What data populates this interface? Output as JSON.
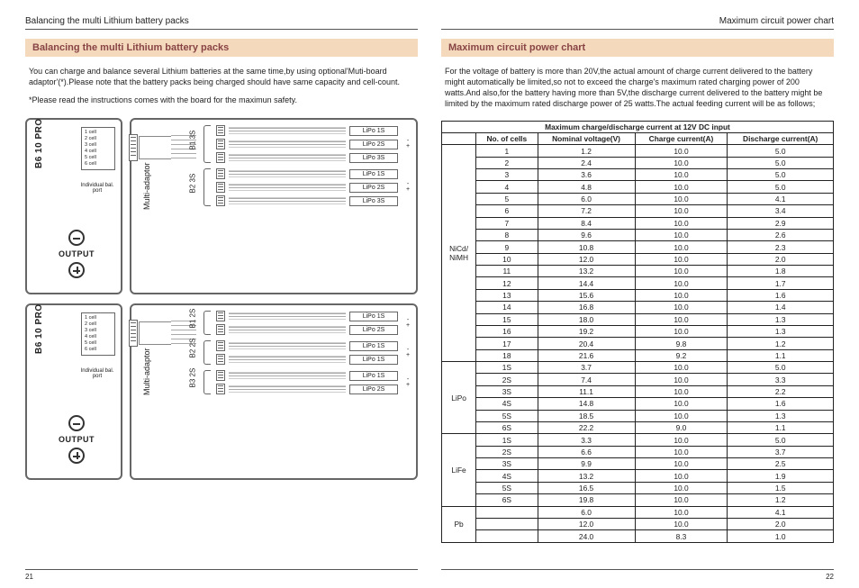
{
  "headerLeft": "Balancing the multi Lithium battery packs",
  "headerRight": "Maximum circuit power chart",
  "left": {
    "title": "Balancing the multi Lithium battery packs",
    "para1": "You can charge and balance several Lithium batteries at the same time,by using optional'Muti-board adaptor'(*).Please note that the battery packs being charged should have same capacity and cell-count.",
    "para2": "*Please read the instructions comes with the board for the maximun safety.",
    "deviceName": "B6 10 PRO",
    "cellLabels": [
      "1 cell",
      "2 cell",
      "3 cell",
      "4 cell",
      "5 cell",
      "6 cell"
    ],
    "cellCaption": "Individual bal. port",
    "output": "OUTPUT",
    "adaptorCaption": "Multi-adaptor",
    "diag1": {
      "groups": [
        {
          "label": "B1 3S",
          "slots": [
            "LiPo 1S",
            "LiPo 2S",
            "LiPo 3S"
          ],
          "pol": true
        },
        {
          "label": "B2 3S",
          "slots": [
            "LiPo 1S",
            "LiPo 2S",
            "LiPo 3S"
          ],
          "pol": true
        }
      ]
    },
    "diag2": {
      "groups": [
        {
          "label": "B1 2S",
          "slots": [
            "LiPo 1S",
            "LiPo 2S"
          ],
          "pol": true
        },
        {
          "label": "B2 2S",
          "slots": [
            "LiPo 1S",
            "LiPo 1S"
          ],
          "pol": true
        },
        {
          "label": "B3 2S",
          "slots": [
            "LiPo 1S",
            "LiPo 2S"
          ],
          "pol": true
        }
      ]
    },
    "pageNo": "21"
  },
  "right": {
    "title": "Maximum circuit power chart",
    "para1": "For the voltage of battery is more than 20V,the actual amount of charge current delivered to the battery might automatically be limited,so not to exceed the charge's maximum rated charging power of 200 watts.And also,for the battery having more than 5V,the discharge current delivered to the battery might be limited by the maximum rated discharge power of 25 watts.The actual feeding current will be as follows;",
    "table": {
      "spanTitle": "Maximum charge/discharge current at 12V DC input",
      "headers": [
        "",
        "No. of cells",
        "Nominal voltage(V)",
        "Charge current(A)",
        "Discharge current(A)"
      ],
      "sections": [
        {
          "type": "NiCd/\nNiMH",
          "rows": [
            [
              "1",
              "1.2",
              "10.0",
              "5.0"
            ],
            [
              "2",
              "2.4",
              "10.0",
              "5.0"
            ],
            [
              "3",
              "3.6",
              "10.0",
              "5.0"
            ],
            [
              "4",
              "4.8",
              "10.0",
              "5.0"
            ],
            [
              "5",
              "6.0",
              "10.0",
              "4.1"
            ],
            [
              "6",
              "7.2",
              "10.0",
              "3.4"
            ],
            [
              "7",
              "8.4",
              "10.0",
              "2.9"
            ],
            [
              "8",
              "9.6",
              "10.0",
              "2.6"
            ],
            [
              "9",
              "10.8",
              "10.0",
              "2.3"
            ],
            [
              "10",
              "12.0",
              "10.0",
              "2.0"
            ],
            [
              "11",
              "13.2",
              "10.0",
              "1.8"
            ],
            [
              "12",
              "14.4",
              "10.0",
              "1.7"
            ],
            [
              "13",
              "15.6",
              "10.0",
              "1.6"
            ],
            [
              "14",
              "16.8",
              "10.0",
              "1.4"
            ],
            [
              "15",
              "18.0",
              "10.0",
              "1.3"
            ],
            [
              "16",
              "19.2",
              "10.0",
              "1.3"
            ],
            [
              "17",
              "20.4",
              "9.8",
              "1.2"
            ],
            [
              "18",
              "21.6",
              "9.2",
              "1.1"
            ]
          ]
        },
        {
          "type": "LiPo",
          "rows": [
            [
              "1S",
              "3.7",
              "10.0",
              "5.0"
            ],
            [
              "2S",
              "7.4",
              "10.0",
              "3.3"
            ],
            [
              "3S",
              "11.1",
              "10.0",
              "2.2"
            ],
            [
              "4S",
              "14.8",
              "10.0",
              "1.6"
            ],
            [
              "5S",
              "18.5",
              "10.0",
              "1.3"
            ],
            [
              "6S",
              "22.2",
              "9.0",
              "1.1"
            ]
          ]
        },
        {
          "type": "LiFe",
          "rows": [
            [
              "1S",
              "3.3",
              "10.0",
              "5.0"
            ],
            [
              "2S",
              "6.6",
              "10.0",
              "3.7"
            ],
            [
              "3S",
              "9.9",
              "10.0",
              "2.5"
            ],
            [
              "4S",
              "13.2",
              "10.0",
              "1.9"
            ],
            [
              "5S",
              "16.5",
              "10.0",
              "1.5"
            ],
            [
              "6S",
              "19.8",
              "10.0",
              "1.2"
            ]
          ]
        },
        {
          "type": "Pb",
          "rows": [
            [
              "",
              "6.0",
              "10.0",
              "4.1"
            ],
            [
              "",
              "12.0",
              "10.0",
              "2.0"
            ],
            [
              "",
              "24.0",
              "8.3",
              "1.0"
            ]
          ]
        }
      ]
    },
    "pageNo": "22"
  }
}
